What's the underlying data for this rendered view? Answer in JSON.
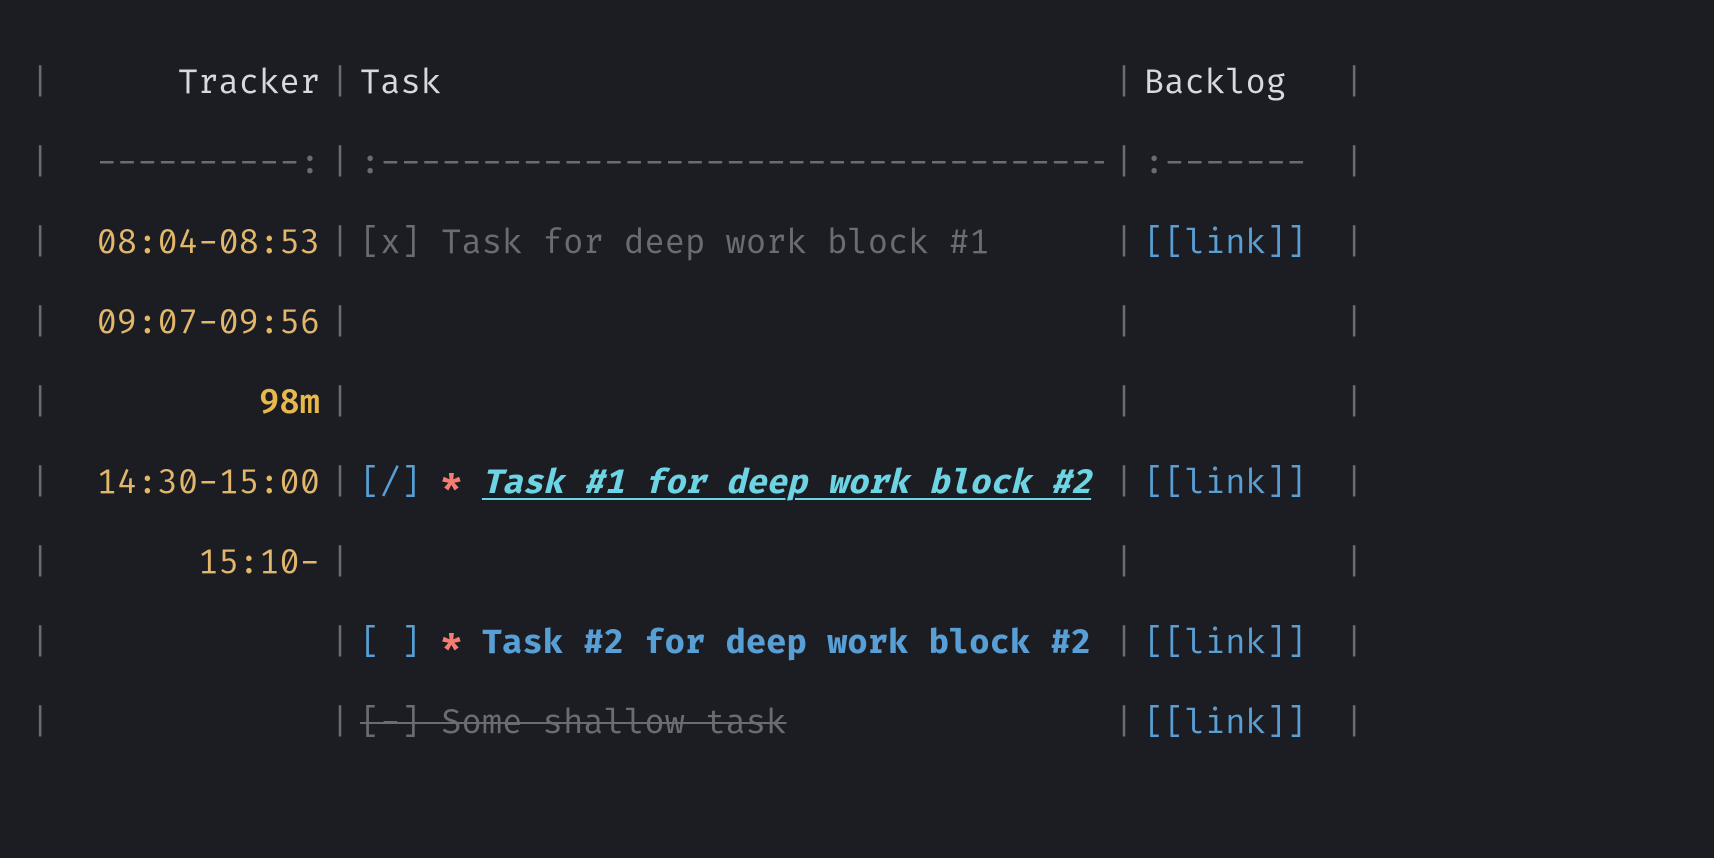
{
  "headers": {
    "tracker": "Tracker",
    "task": "Task",
    "backlog": "Backlog"
  },
  "divider": {
    "tracker": "----------:",
    "task": ":------------------------------------",
    "backlog": ":-------"
  },
  "rows": {
    "r1": {
      "tracker": "08:04-08:53",
      "checkbox": "[x]",
      "task": " Task for deep work block #1",
      "backlog": "[[link]]"
    },
    "r2": {
      "tracker": "09:07-09:56"
    },
    "r3": {
      "tracker": "98m"
    },
    "r4": {
      "tracker": "14:30-15:00",
      "checkbox": "[/]",
      "star": " * ",
      "task": "Task #1 for deep work block #2",
      "backlog": "[[link]]"
    },
    "r5": {
      "tracker": "15:10-"
    },
    "r6": {
      "checkbox": "[ ]",
      "star": " * ",
      "task": "Task #2 for deep work block #2",
      "backlog": "[[link]]"
    },
    "r7": {
      "checkbox": "[-]",
      "task": " Some shallow task",
      "backlog": "[[link]]"
    }
  }
}
